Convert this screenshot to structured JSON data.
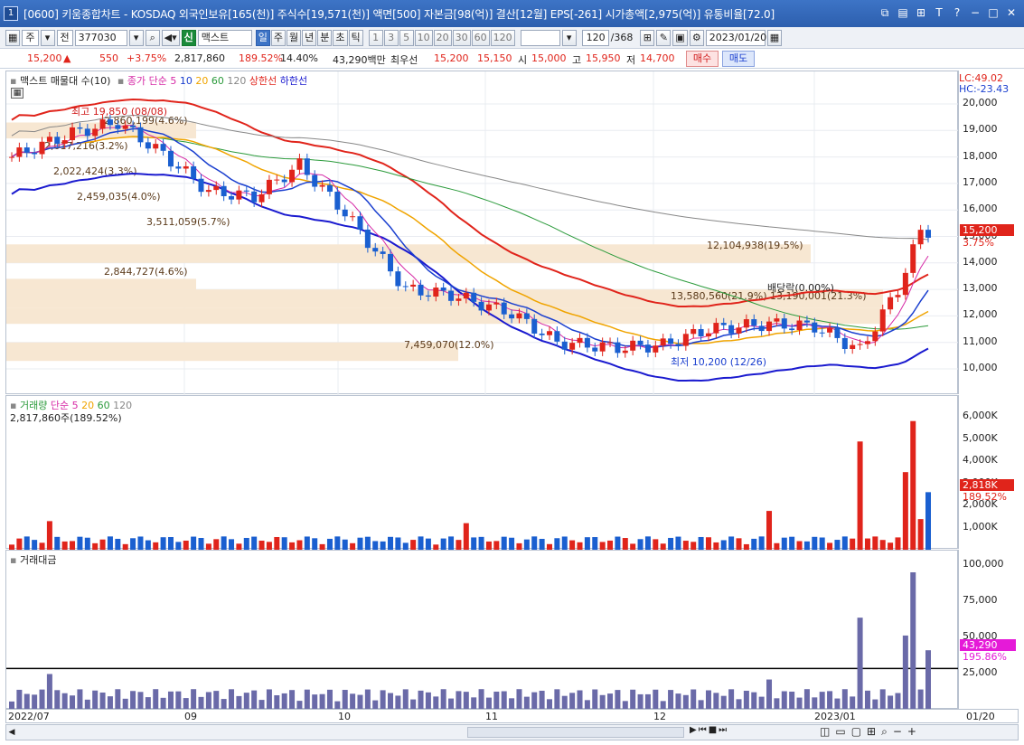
{
  "window": {
    "number": "1",
    "title": "[0600] 키움종합차트 - KOSDAQ 외국인보유[165(천)] 주식수[19,571(천)] 액면[500] 자본금[98(억)] 결산[12월] EPS[-261] 시가총액[2,975(억)] 유통비율[72.0]"
  },
  "toolbar": {
    "period_week": "주",
    "period_all": "전",
    "code": "377030",
    "badge_shin": "신",
    "stock_name": "맥스트",
    "tabs": [
      "일",
      "주",
      "월",
      "년",
      "분",
      "초",
      "틱"
    ],
    "active_tab": "일",
    "intervals": [
      "1",
      "3",
      "5",
      "10",
      "20",
      "30",
      "60",
      "120"
    ],
    "count": "120",
    "total": "/368",
    "date": "2023/01/20"
  },
  "price": {
    "current": "15,200",
    "change_arrow": "▲",
    "change": "550",
    "change_pct": "+3.75%",
    "volume": "2,817,860",
    "volume_ratio": "189.52%",
    "turnover": "14.40%",
    "amount": "43,290백만",
    "best_label": "최우선",
    "best_ask": "15,200",
    "best_bid": "15,150",
    "open_label": "시",
    "open": "15,000",
    "high_label": "고",
    "high": "15,950",
    "low_label": "저",
    "low": "14,700",
    "buy_label": "매수",
    "sell_label": "매도"
  },
  "price_panel": {
    "legend_name": "맥스트 매물대 수(10)",
    "legend_close": "종가 단순",
    "ma_labels": [
      "5",
      "10",
      "20",
      "60",
      "120"
    ],
    "upper_band": "상한선",
    "lower_band": "하한선",
    "lc": "LC:49.02",
    "hc": "HC:-23.43",
    "ticks": [
      "20,000",
      "19,000",
      "18,000",
      "17,000",
      "16,000",
      "15,000",
      "14,000",
      "13,000",
      "12,000",
      "11,000",
      "10,000"
    ],
    "current_tag": "15,200",
    "current_pct": "3.75%",
    "high_note": "최고 19,850 (08/08)",
    "low_note": "최저 10,200 (12/26)",
    "dividend_note": "배당락(0.00%)",
    "volume_profile": [
      "2,860,199(4.6%)",
      "2,017,216(3.2%)",
      "2,022,424(3.3%)",
      "2,459,035(4.0%)",
      "3,511,059(5.7%)",
      "12,104,938(19.5%)",
      "2,844,727(4.6%)",
      "13,580,560(21.9%)",
      "13,190,001(21.3%)",
      "7,459,070(12.0%)"
    ]
  },
  "volume_panel": {
    "legend_name": "거래량",
    "legend_ma": "단순",
    "ma_labels": [
      "5",
      "20",
      "60",
      "120"
    ],
    "current_note": "2,817,860주(189.52%)",
    "ticks": [
      "6,000K",
      "5,000K",
      "4,000K",
      "3,000K",
      "2,000K",
      "1,000K"
    ],
    "current_tag": "2,818K",
    "current_pct": "189.52%"
  },
  "amount_panel": {
    "legend_name": "거래대금",
    "ticks": [
      "100,000",
      "75,000",
      "50,000",
      "25,000"
    ],
    "current_tag": "43,290",
    "current_pct": "195.86%"
  },
  "x_axis": {
    "labels": [
      "2022/07",
      "09",
      "10",
      "11",
      "12",
      "2023/01",
      "01/20"
    ]
  },
  "colors": {
    "up": "#e0241b",
    "down": "#1a5fd0",
    "upper_band": "#e0241b",
    "lower_band": "#1a1acf",
    "ma5": "#d62aa6",
    "ma10": "#1a3fcf",
    "ma20": "#f0a400",
    "ma60": "#2a9a3a",
    "ma120": "#888888",
    "profile": "#f7e7d2"
  }
}
